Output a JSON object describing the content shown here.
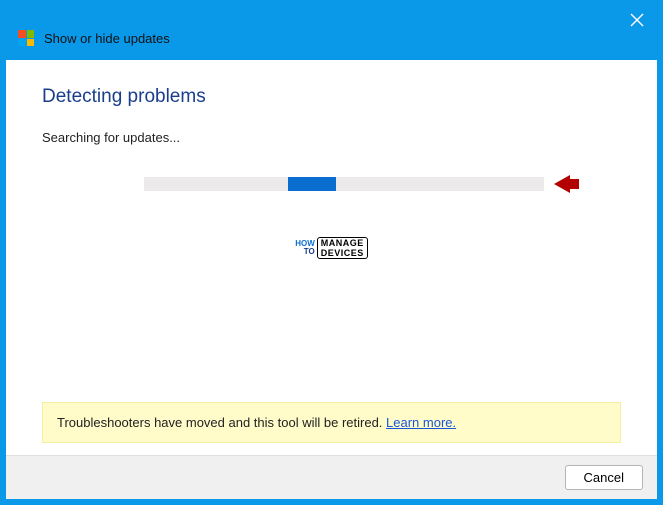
{
  "titlebar": {
    "title": "Show or hide updates"
  },
  "content": {
    "heading": "Detecting problems",
    "status": "Searching for updates...",
    "notice_text": "Troubleshooters have moved and this tool will be retired. ",
    "notice_link": "Learn more."
  },
  "watermark": {
    "line1_a": "HOW",
    "line1_b": "TO",
    "line2_a": "MANAGE",
    "line2_b": "DEVICES"
  },
  "footer": {
    "cancel": "Cancel"
  }
}
